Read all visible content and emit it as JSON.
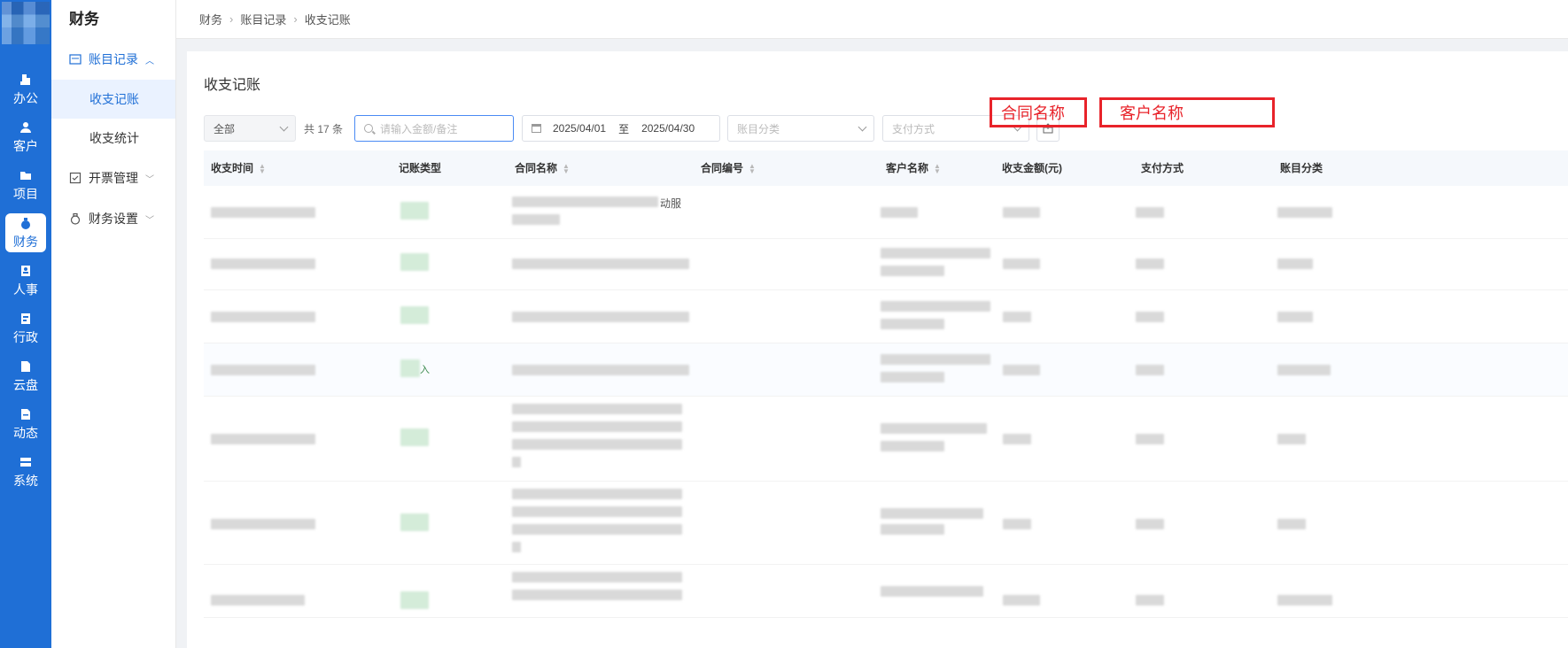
{
  "rail": {
    "items": [
      {
        "label": "办公",
        "icon": "office-icon"
      },
      {
        "label": "客户",
        "icon": "customer-icon"
      },
      {
        "label": "项目",
        "icon": "folder-icon"
      },
      {
        "label": "财务",
        "icon": "money-bag-icon",
        "active": true
      },
      {
        "label": "人事",
        "icon": "person-card-icon"
      },
      {
        "label": "行政",
        "icon": "admin-icon"
      },
      {
        "label": "云盘",
        "icon": "cloud-disk-icon"
      },
      {
        "label": "动态",
        "icon": "feed-icon"
      },
      {
        "label": "系统",
        "icon": "system-icon"
      }
    ]
  },
  "submenu": {
    "title": "财务",
    "groups": [
      {
        "label": "账目记录",
        "open": true,
        "children": [
          {
            "label": "收支记账",
            "active": true
          },
          {
            "label": "收支统计"
          }
        ]
      },
      {
        "label": "开票管理"
      },
      {
        "label": "财务设置"
      }
    ]
  },
  "breadcrumb": {
    "items": [
      "财务",
      "账目记录",
      "收支记账"
    ]
  },
  "page": {
    "title": "收支记账"
  },
  "filters": {
    "type_select": "全部",
    "count_text": "共 17 条",
    "search_placeholder": "请输入金额/备注",
    "date_start": "2025/04/01",
    "date_to": "至",
    "date_end": "2025/04/30",
    "category_placeholder": "账目分类",
    "payment_placeholder": "支付方式"
  },
  "annotations": {
    "contract_name": "合同名称",
    "customer_name": "客户名称"
  },
  "table": {
    "columns": [
      "收支时间",
      "记账类型",
      "合同名称",
      "合同编号",
      "客户名称",
      "收支金额(元)",
      "支付方式",
      "账目分类"
    ],
    "row_fragments": [
      "动服",
      "入"
    ]
  },
  "colors": {
    "primary": "#1f6fd6",
    "annotation_red": "#e8232a",
    "tag_green": "#d4ecd9"
  }
}
